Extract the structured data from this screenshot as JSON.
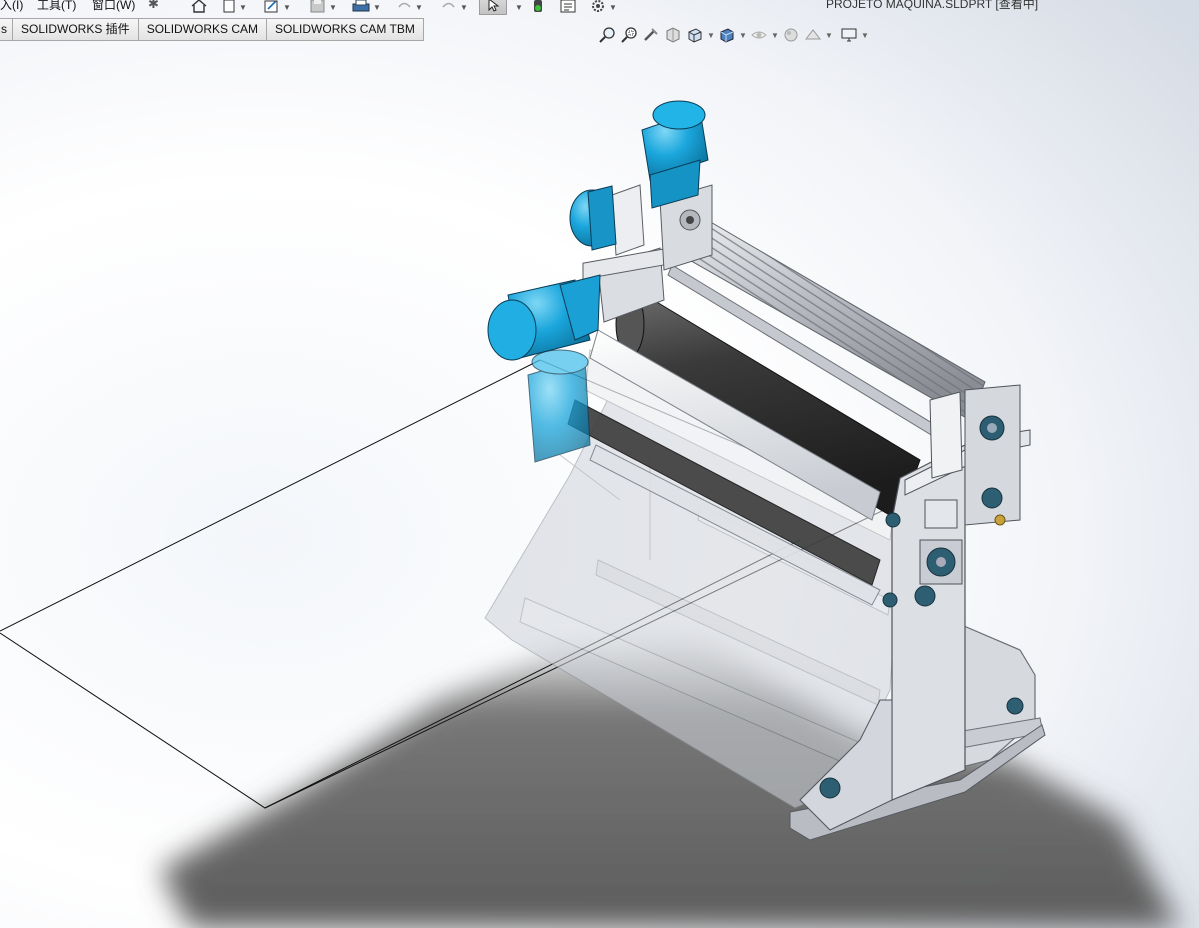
{
  "app": {
    "document_title": "PROJETO MAQUINA.SLDPRT [查看中]"
  },
  "menu": {
    "items": [
      {
        "label": "入(I)"
      },
      {
        "label": "工具(T)"
      },
      {
        "label": "窗口(W)"
      }
    ]
  },
  "toolbar": {
    "icons": [
      "home-icon",
      "new-document-icon",
      "sketch-icon",
      "save-icon",
      "print-icon",
      "undo-icon",
      "redo-icon",
      "select-arrow-icon",
      "traffic-light-icon",
      "options-icon",
      "settings-icon"
    ]
  },
  "command_tabs": [
    {
      "label": "s"
    },
    {
      "label": "SOLIDWORKS 插件"
    },
    {
      "label": "SOLIDWORKS CAM"
    },
    {
      "label": "SOLIDWORKS CAM TBM"
    }
  ],
  "view_toolbar": {
    "icons": [
      "zoom-to-fit-icon",
      "zoom-to-area-icon",
      "previous-view-icon",
      "section-view-icon",
      "view-orientation-icon",
      "display-style-icon",
      "hide-show-items-icon",
      "edit-appearance-icon",
      "apply-scene-icon",
      "view-settings-icon"
    ]
  },
  "colors": {
    "motor_blue": "#1aa6dc",
    "roller_dark": "#333333",
    "frame_grey": "#d2d5da",
    "shadow": "#6f6f6f"
  }
}
